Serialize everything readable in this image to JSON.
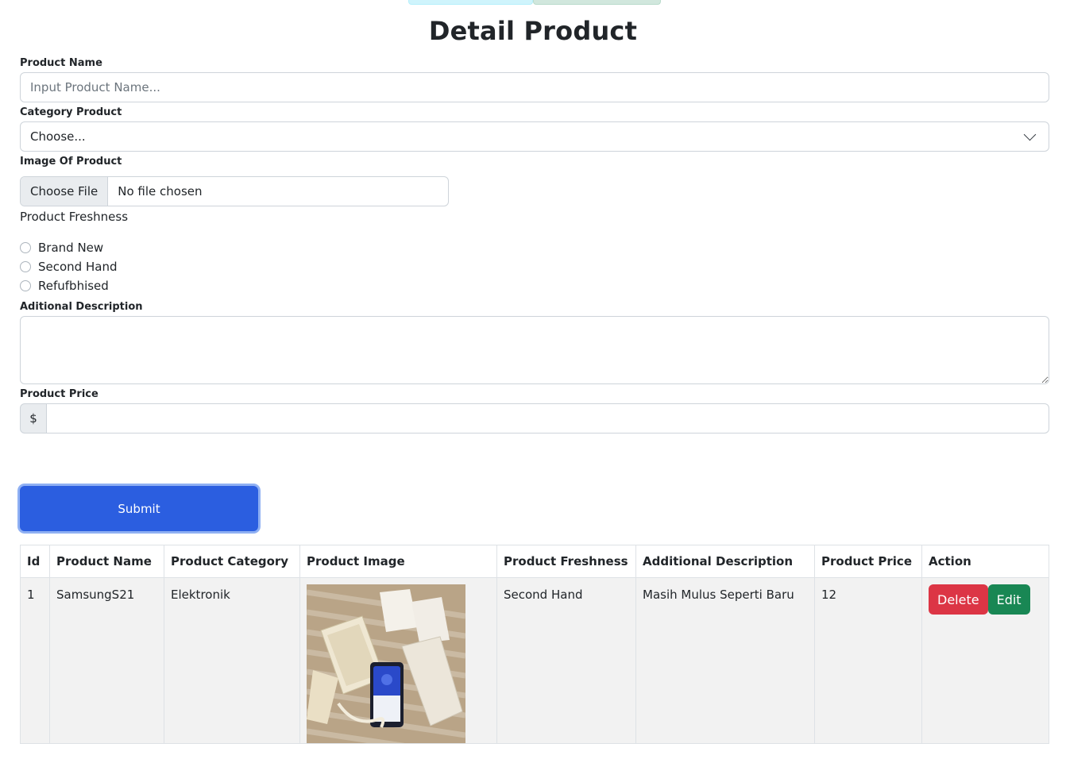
{
  "page": {
    "title": "Detail Product"
  },
  "form": {
    "name_label": "Product Name",
    "name_placeholder": "Input Product Name...",
    "category_label": "Category Product",
    "category_selected": "Choose...",
    "image_label": "Image Of Product",
    "file_button": "Choose File",
    "file_status": "No file chosen",
    "freshness_label": "Product Freshness",
    "freshness_options": [
      "Brand New",
      "Second Hand",
      "Refufbhised"
    ],
    "description_label": "Aditional Description",
    "price_label": "Product Price",
    "price_prefix": "$",
    "submit_label": "Submit"
  },
  "table": {
    "headers": [
      "Id",
      "Product Name",
      "Product Category",
      "Product Image",
      "Product Freshness",
      "Additional Description",
      "Product Price",
      "Action"
    ],
    "rows": [
      {
        "id": "1",
        "name": "SamsungS21",
        "category": "Elektronik",
        "freshness": "Second Hand",
        "description": "Masih Mulus Seperti Baru",
        "price": "12",
        "delete_label": "Delete",
        "edit_label": "Edit"
      }
    ]
  },
  "colors": {
    "primary": "#2b5ee0",
    "danger": "#dc3545",
    "success": "#198754"
  }
}
